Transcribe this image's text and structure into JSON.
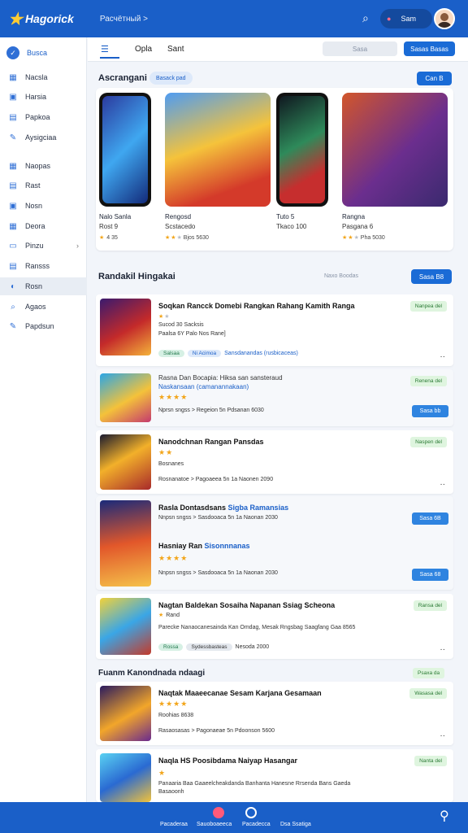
{
  "topbar": {
    "brand": "Hagorick",
    "crumb": "Расчётный >",
    "pill_label": "Sam"
  },
  "sidebar": {
    "top": "Busca",
    "items": [
      {
        "label": "Nacsla",
        "icon": "house-icon"
      },
      {
        "label": "Harsia",
        "icon": "lock-icon"
      },
      {
        "label": "Papkoa",
        "icon": "document-icon"
      },
      {
        "label": "Aysigciaa",
        "icon": "pen-icon"
      },
      {
        "label": "Naopas",
        "icon": "grid-icon"
      },
      {
        "label": "Rast",
        "icon": "list-icon"
      },
      {
        "label": "Nosn",
        "icon": "card-icon"
      },
      {
        "label": "Deora",
        "icon": "calendar-icon"
      },
      {
        "label": "Pinzu",
        "icon": "folder-icon"
      },
      {
        "label": "Ransss",
        "icon": "inbox-icon"
      },
      {
        "label": "Rosn",
        "icon": "compass-icon"
      },
      {
        "label": "Agaos",
        "icon": "search-icon"
      },
      {
        "label": "Papdsun",
        "icon": "tool-icon"
      }
    ]
  },
  "subbar": {
    "tab1": "Opla",
    "tab2": "Sant",
    "search": "Sasa",
    "button": "Sasas Basas"
  },
  "featured": {
    "title": "Ascrangani",
    "badge": "Basack pad",
    "button": "Can B",
    "cards": [
      {
        "title": "Nalo Sanla",
        "subtitle": "Rost 9",
        "rating": "4 35"
      },
      {
        "title": "Rengosd",
        "subtitle": "Scstacedo",
        "rating": "Bjos 5630"
      },
      {
        "title": "Tuto 5",
        "subtitle": "Tkaco 100",
        "rating": ""
      },
      {
        "title": "Rangna",
        "subtitle": "Pasgana 6",
        "rating": "Pha 5030"
      }
    ]
  },
  "ranking": {
    "title": "Randakil Hingakai",
    "hint": "Naxo Boodas",
    "button": "Sasa B8"
  },
  "items": [
    {
      "title": "Soqkan Rancck Domebi Rangkan Rahang Kamith Ranga",
      "tag": "Nanpea del",
      "sub1": "Sucod 30 Sacksis",
      "sub2": "Paalsa 6Y Palo Nos Rane]",
      "chips": [
        "Salsaa",
        "Ni Acimoa"
      ],
      "chip_text": "Sansdanandas (rusbicaceas)"
    },
    {
      "title": "Rasna Dan Bocapia: Hiksa san sansteraud",
      "link": "Naskansaan (camanannakaan)",
      "tag": "Renena del",
      "meta": "Nprsn sngss > Regeion 5n Pdsanan 6030",
      "button": "Sasa bb"
    },
    {
      "title": "Nanodchnan Rangan Pansdas",
      "tag": "Naspen del",
      "sub1": "Bosnanes",
      "meta": "Rosnanatoe > Pagoaeea 5n 1a Naonen 2090"
    },
    {
      "title": "Rasla Dontasdsans",
      "title_link": "Sigba Ramansias",
      "meta": "Nnpsn sngss > Sasdooaca 5n 1a Naonan 2030",
      "title2": "Hasniay Ran",
      "link2": "Sisonnnanas",
      "button": "Sasa 6B",
      "button2": "Sasa 68"
    },
    {
      "title": "Nagtan Baldekan Sosaiha Napanan Ssiag Scheona",
      "tag": "Ransa del",
      "sub1": "Rand",
      "sub2": "Parecke Nanaocanesainda Kan Omdag, Mesak Rngsbag Saagfang Gaa 8565",
      "chips": [
        "Rossa",
        "Sydessbasteas"
      ],
      "chip_text": "Nesoda 2000"
    },
    {
      "title": "Naqtak Maaeecanae Sesam Karjana Gesamaan",
      "tag": "Wasasa del",
      "sub1": "Roohias 8638",
      "meta": "Rasaosasas > Pagonaeae 5n Pdoonson 5600"
    },
    {
      "title": "Naqla HS Poosibdama Naiyap Hasangar",
      "tag": "Nanta del",
      "sub1": "Panaaria Baa Gaaeelcheakdanda Banhanta Hanesne Rrsenda Bans Gaeda",
      "sub2": "Basaoonh"
    }
  ],
  "section3": {
    "title": "Fuanm Kanondnada ndaagi",
    "tag": "Psaxa da"
  },
  "bottomnav": {
    "items": [
      "Pacaderaa",
      "Sauoboaeeca",
      "Pacadecca",
      "Dsa Ssatiga"
    ]
  }
}
